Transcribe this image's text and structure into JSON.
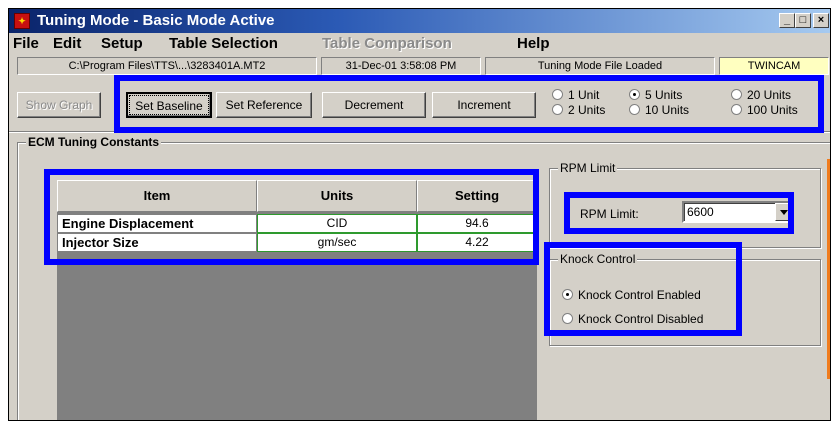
{
  "window": {
    "title": "Tuning Mode - Basic Mode Active",
    "icon": "app-tuner-icon",
    "controls": [
      "_",
      "□",
      "×"
    ]
  },
  "menu": [
    "File",
    "Edit",
    "Setup",
    "Table Selection",
    "Table Comparison",
    "Help"
  ],
  "status": {
    "file_path": "C:\\Program Files\\TTS\\...\\3283401A.MT2",
    "timestamp": "31-Dec-01 3:58:08 PM",
    "mode_state": "Tuning Mode File Loaded",
    "engine": "TWINCAM"
  },
  "toolbar": {
    "show_graph": "Show Graph",
    "set_baseline": "Set Baseline",
    "set_reference": "Set Reference",
    "decrement": "Decrement",
    "increment": "Increment",
    "step_options": [
      "1 Unit",
      "5 Units",
      "20 Units",
      "2 Units",
      "10 Units",
      "100 Units"
    ],
    "step_selected": "5 Units"
  },
  "constants": {
    "section_title": "ECM Tuning Constants",
    "columns": [
      "Item",
      "Units",
      "Setting"
    ],
    "rows": [
      {
        "item": "Engine Displacement",
        "units": "CID",
        "setting": "94.6"
      },
      {
        "item": "Injector Size",
        "units": "gm/sec",
        "setting": "4.22"
      }
    ]
  },
  "rpm": {
    "group_title": "RPM Limit",
    "label": "RPM Limit:",
    "value": "6600"
  },
  "knock": {
    "group_title": "Knock Control",
    "options": [
      "Knock Control Enabled",
      "Knock Control Disabled"
    ],
    "selected": "Knock Control Enabled"
  },
  "colors": {
    "highlight": "#0000ff",
    "title_bar": "#0a246a",
    "grid_border": "#2e9a2e",
    "accent_bar": "#f07c1e"
  }
}
